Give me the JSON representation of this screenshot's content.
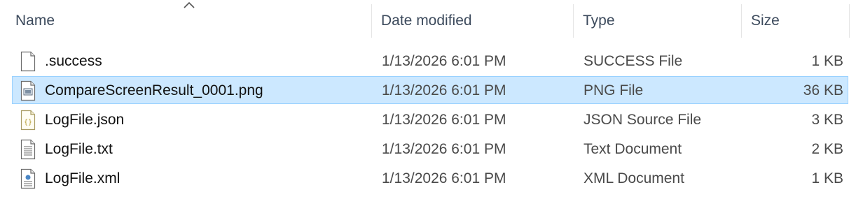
{
  "columns": {
    "name": "Name",
    "date_modified": "Date modified",
    "type": "Type",
    "size": "Size"
  },
  "sort": {
    "column": "name",
    "direction": "ascending",
    "icon": "sort-up-caret-icon"
  },
  "selection_color": "#cce8ff",
  "selection_border": "#99d1ff",
  "files": [
    {
      "name": ".success",
      "date": "1/13/2026 6:01 PM",
      "type": "SUCCESS File",
      "size": "1 KB",
      "icon": "blank-file-icon",
      "selected": false
    },
    {
      "name": "CompareScreenResult_0001.png",
      "date": "1/13/2026 6:01 PM",
      "type": "PNG File",
      "size": "36 KB",
      "icon": "image-file-icon",
      "selected": true
    },
    {
      "name": "LogFile.json",
      "date": "1/13/2026 6:01 PM",
      "type": "JSON Source File",
      "size": "3 KB",
      "icon": "json-file-icon",
      "selected": false
    },
    {
      "name": "LogFile.txt",
      "date": "1/13/2026 6:01 PM",
      "type": "Text Document",
      "size": "2 KB",
      "icon": "text-file-icon",
      "selected": false
    },
    {
      "name": "LogFile.xml",
      "date": "1/13/2026 6:01 PM",
      "type": "XML Document",
      "size": "1 KB",
      "icon": "xml-file-icon",
      "selected": false
    }
  ]
}
